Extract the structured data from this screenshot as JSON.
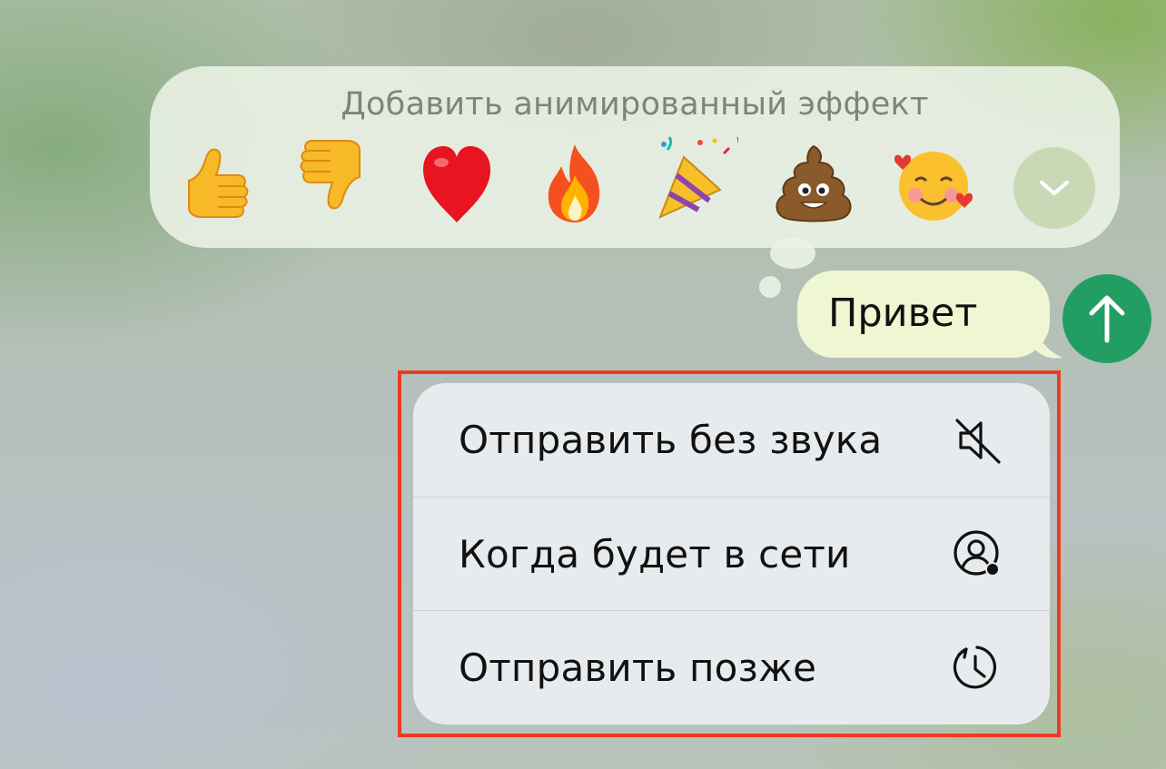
{
  "reactions": {
    "title": "Добавить анимированный эффект",
    "emojis": [
      {
        "icon": "thumbs-up",
        "glyph": "👍"
      },
      {
        "icon": "thumbs-down",
        "glyph": "👎"
      },
      {
        "icon": "red-heart",
        "glyph": "❤"
      },
      {
        "icon": "fire",
        "glyph": "🔥"
      },
      {
        "icon": "party-popper",
        "glyph": "🎉"
      },
      {
        "icon": "pile-of-poo",
        "glyph": "💩"
      },
      {
        "icon": "smiling-face-with-hearts",
        "glyph": "🥰"
      }
    ],
    "expand_icon": "chevron-down-icon"
  },
  "message": {
    "text": "Привет"
  },
  "send_button": {
    "icon": "arrow-up-icon",
    "color": "#239e63"
  },
  "send_menu": {
    "items": [
      {
        "label": "Отправить без звука",
        "icon": "bell-muted-icon"
      },
      {
        "label": "Когда будет в сети",
        "icon": "user-online-icon"
      },
      {
        "label": "Отправить позже",
        "icon": "scheduled-clock-icon"
      }
    ]
  },
  "highlight_color": "#ee3a24"
}
